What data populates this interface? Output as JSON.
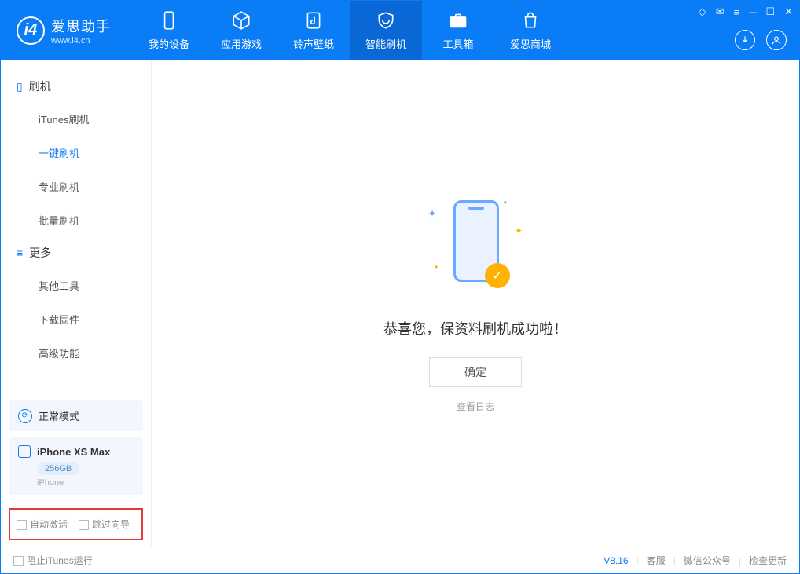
{
  "app": {
    "name_cn": "爱思助手",
    "name_en": "www.i4.cn"
  },
  "nav": {
    "items": [
      {
        "label": "我的设备"
      },
      {
        "label": "应用游戏"
      },
      {
        "label": "铃声壁纸"
      },
      {
        "label": "智能刷机"
      },
      {
        "label": "工具箱"
      },
      {
        "label": "爱思商城"
      }
    ]
  },
  "sidebar": {
    "section1_title": "刷机",
    "section1_items": [
      {
        "label": "iTunes刷机"
      },
      {
        "label": "一键刷机"
      },
      {
        "label": "专业刷机"
      },
      {
        "label": "批量刷机"
      }
    ],
    "section2_title": "更多",
    "section2_items": [
      {
        "label": "其他工具"
      },
      {
        "label": "下载固件"
      },
      {
        "label": "高级功能"
      }
    ],
    "status_label": "正常模式",
    "device": {
      "name": "iPhone XS Max",
      "capacity": "256GB",
      "type": "iPhone"
    },
    "check1": "自动激活",
    "check2": "跳过向导"
  },
  "main": {
    "success_text": "恭喜您，保资料刷机成功啦！",
    "ok_button": "确定",
    "log_link": "查看日志"
  },
  "footer": {
    "block_itunes": "阻止iTunes运行",
    "version": "V8.16",
    "links": [
      "客服",
      "微信公众号",
      "检查更新"
    ]
  }
}
